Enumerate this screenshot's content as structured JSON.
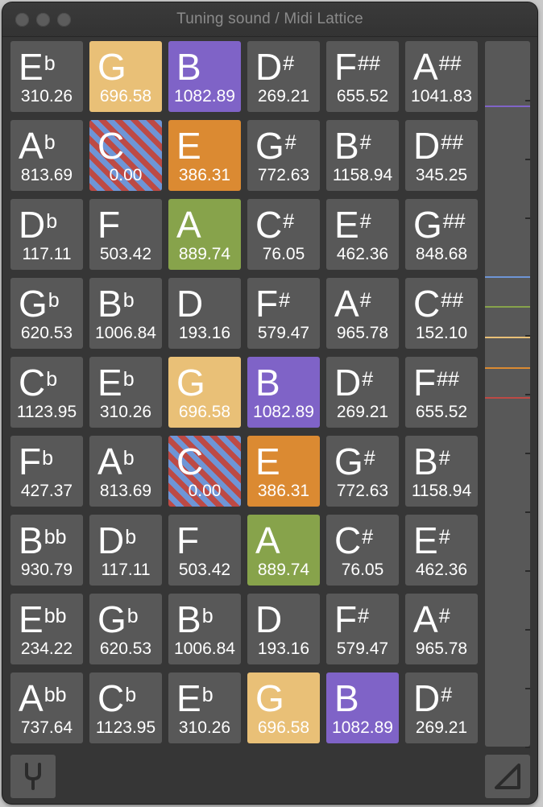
{
  "window": {
    "title": "Tuning sound / Midi Lattice"
  },
  "grid": {
    "rows": [
      [
        {
          "name": "E",
          "acc": "b",
          "cents": "310.26",
          "hl": ""
        },
        {
          "name": "G",
          "acc": "",
          "cents": "696.58",
          "hl": "g"
        },
        {
          "name": "B",
          "acc": "",
          "cents": "1082.89",
          "hl": "b"
        },
        {
          "name": "D",
          "acc": "#",
          "cents": "269.21",
          "hl": ""
        },
        {
          "name": "F",
          "acc": "##",
          "cents": "655.52",
          "hl": ""
        },
        {
          "name": "A",
          "acc": "##",
          "cents": "1041.83",
          "hl": ""
        }
      ],
      [
        {
          "name": "A",
          "acc": "b",
          "cents": "813.69",
          "hl": ""
        },
        {
          "name": "C",
          "acc": "",
          "cents": "0.00",
          "hl": "c"
        },
        {
          "name": "E",
          "acc": "",
          "cents": "386.31",
          "hl": "e"
        },
        {
          "name": "G",
          "acc": "#",
          "cents": "772.63",
          "hl": ""
        },
        {
          "name": "B",
          "acc": "#",
          "cents": "1158.94",
          "hl": ""
        },
        {
          "name": "D",
          "acc": "##",
          "cents": "345.25",
          "hl": ""
        }
      ],
      [
        {
          "name": "D",
          "acc": "b",
          "cents": "117.11",
          "hl": ""
        },
        {
          "name": "F",
          "acc": "",
          "cents": "503.42",
          "hl": ""
        },
        {
          "name": "A",
          "acc": "",
          "cents": "889.74",
          "hl": "a"
        },
        {
          "name": "C",
          "acc": "#",
          "cents": "76.05",
          "hl": ""
        },
        {
          "name": "E",
          "acc": "#",
          "cents": "462.36",
          "hl": ""
        },
        {
          "name": "G",
          "acc": "##",
          "cents": "848.68",
          "hl": ""
        }
      ],
      [
        {
          "name": "G",
          "acc": "b",
          "cents": "620.53",
          "hl": ""
        },
        {
          "name": "B",
          "acc": "b",
          "cents": "1006.84",
          "hl": ""
        },
        {
          "name": "D",
          "acc": "",
          "cents": "193.16",
          "hl": ""
        },
        {
          "name": "F",
          "acc": "#",
          "cents": "579.47",
          "hl": ""
        },
        {
          "name": "A",
          "acc": "#",
          "cents": "965.78",
          "hl": ""
        },
        {
          "name": "C",
          "acc": "##",
          "cents": "152.10",
          "hl": ""
        }
      ],
      [
        {
          "name": "C",
          "acc": "b",
          "cents": "1123.95",
          "hl": ""
        },
        {
          "name": "E",
          "acc": "b",
          "cents": "310.26",
          "hl": ""
        },
        {
          "name": "G",
          "acc": "",
          "cents": "696.58",
          "hl": "g"
        },
        {
          "name": "B",
          "acc": "",
          "cents": "1082.89",
          "hl": "b"
        },
        {
          "name": "D",
          "acc": "#",
          "cents": "269.21",
          "hl": ""
        },
        {
          "name": "F",
          "acc": "##",
          "cents": "655.52",
          "hl": ""
        }
      ],
      [
        {
          "name": "F",
          "acc": "b",
          "cents": "427.37",
          "hl": ""
        },
        {
          "name": "A",
          "acc": "b",
          "cents": "813.69",
          "hl": ""
        },
        {
          "name": "C",
          "acc": "",
          "cents": "0.00",
          "hl": "c"
        },
        {
          "name": "E",
          "acc": "",
          "cents": "386.31",
          "hl": "e"
        },
        {
          "name": "G",
          "acc": "#",
          "cents": "772.63",
          "hl": ""
        },
        {
          "name": "B",
          "acc": "#",
          "cents": "1158.94",
          "hl": ""
        }
      ],
      [
        {
          "name": "B",
          "acc": "bb",
          "cents": "930.79",
          "hl": ""
        },
        {
          "name": "D",
          "acc": "b",
          "cents": "117.11",
          "hl": ""
        },
        {
          "name": "F",
          "acc": "",
          "cents": "503.42",
          "hl": ""
        },
        {
          "name": "A",
          "acc": "",
          "cents": "889.74",
          "hl": "a"
        },
        {
          "name": "C",
          "acc": "#",
          "cents": "76.05",
          "hl": ""
        },
        {
          "name": "E",
          "acc": "#",
          "cents": "462.36",
          "hl": ""
        }
      ],
      [
        {
          "name": "E",
          "acc": "bb",
          "cents": "234.22",
          "hl": ""
        },
        {
          "name": "G",
          "acc": "b",
          "cents": "620.53",
          "hl": ""
        },
        {
          "name": "B",
          "acc": "b",
          "cents": "1006.84",
          "hl": ""
        },
        {
          "name": "D",
          "acc": "",
          "cents": "193.16",
          "hl": ""
        },
        {
          "name": "F",
          "acc": "#",
          "cents": "579.47",
          "hl": ""
        },
        {
          "name": "A",
          "acc": "#",
          "cents": "965.78",
          "hl": ""
        }
      ],
      [
        {
          "name": "A",
          "acc": "bb",
          "cents": "737.64",
          "hl": ""
        },
        {
          "name": "C",
          "acc": "b",
          "cents": "1123.95",
          "hl": ""
        },
        {
          "name": "E",
          "acc": "b",
          "cents": "310.26",
          "hl": ""
        },
        {
          "name": "G",
          "acc": "",
          "cents": "696.58",
          "hl": "g"
        },
        {
          "name": "B",
          "acc": "",
          "cents": "1082.89",
          "hl": "b"
        },
        {
          "name": "D",
          "acc": "#",
          "cents": "269.21",
          "hl": ""
        }
      ]
    ]
  },
  "meter": {
    "lines": [
      {
        "color": "#8064c8",
        "level": 0.909
      },
      {
        "color": "#6e95d6",
        "level": 0.667
      },
      {
        "color": "#87a34b",
        "level": 0.624
      },
      {
        "color": "#e9c077",
        "level": 0.581
      },
      {
        "color": "#db8a32",
        "level": 0.538
      },
      {
        "color": "#bd4a45",
        "level": 0.496
      }
    ]
  },
  "toolbar": {
    "tuning_fork_icon": "tuning-fork-icon",
    "resize_icon": "resize-corner-icon"
  }
}
